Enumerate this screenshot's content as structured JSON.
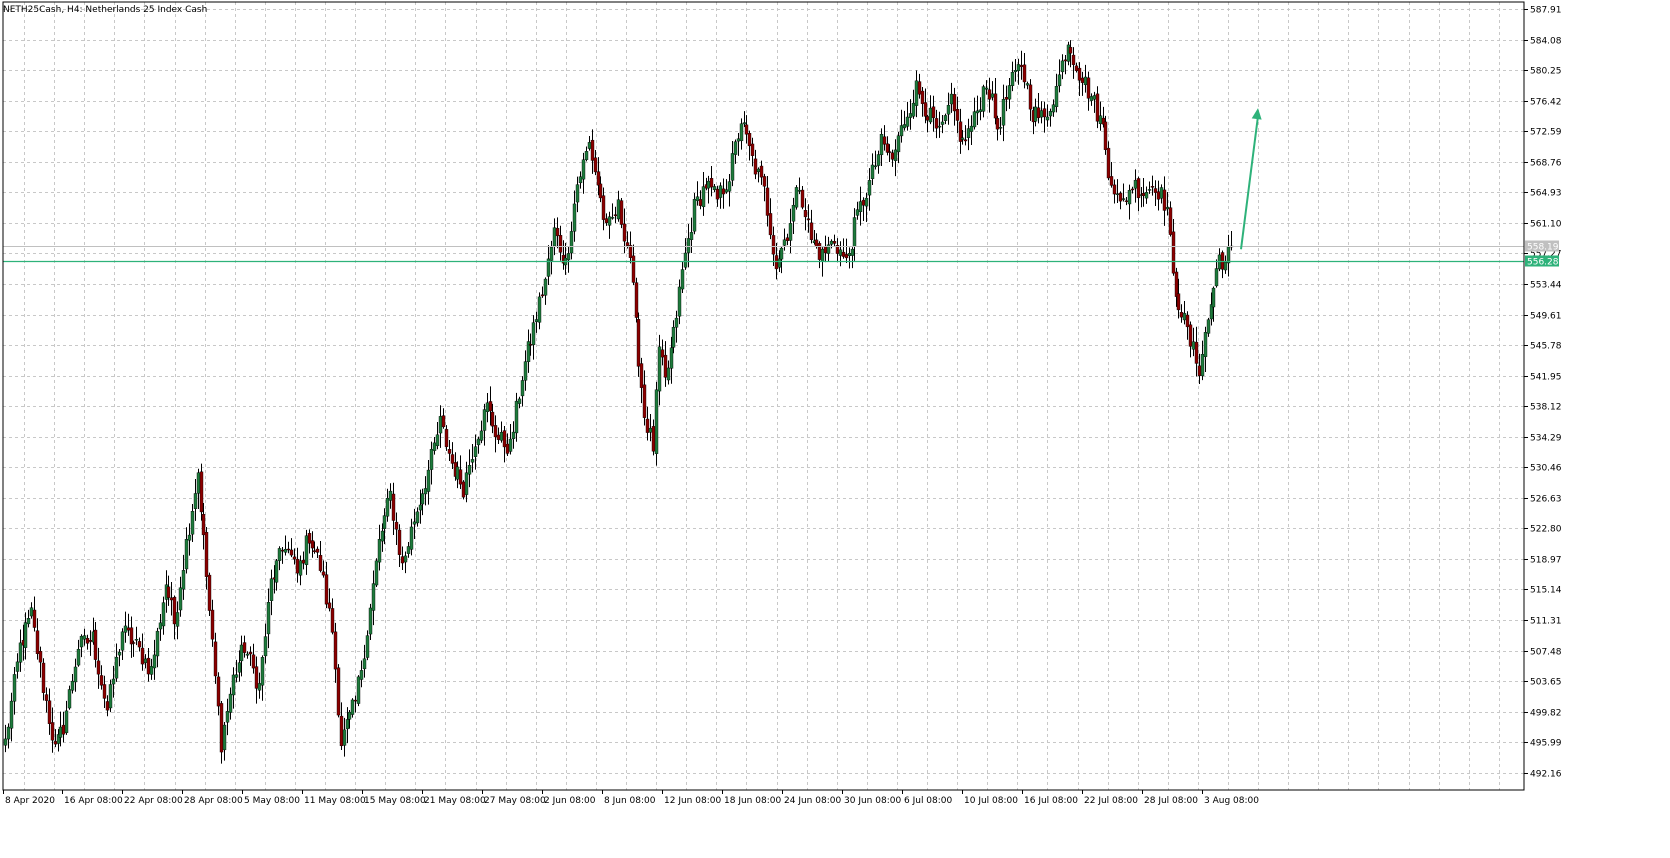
{
  "window": {
    "title": "NETH25Cash, H4:  Netherlands 25 Index Cash"
  },
  "colors": {
    "bull": "#1e7a3c",
    "bear": "#8b0000",
    "grid": "#c8c8c8",
    "level": "#2eb27a",
    "arrow": "#2eb27a",
    "bid": "#c0c0c0"
  },
  "chart_data": {
    "type": "candlestick",
    "title": "NETH25Cash, H4:  Netherlands 25 Index Cash",
    "ylim": [
      490.0,
      588.8
    ],
    "y_ticks": [
      "587.91",
      "584.08",
      "580.25",
      "576.42",
      "572.59",
      "568.76",
      "564.93",
      "561.10",
      "557.27",
      "553.44",
      "549.61",
      "545.78",
      "541.95",
      "538.12",
      "534.29",
      "530.46",
      "526.63",
      "522.80",
      "518.97",
      "515.14",
      "511.31",
      "507.48",
      "503.65",
      "499.82",
      "495.99",
      "492.16"
    ],
    "x_ticks": [
      "8 Apr 2020",
      "16 Apr 08:00",
      "22 Apr 08:00",
      "28 Apr 08:00",
      "5 May 08:00",
      "11 May 08:00",
      "15 May 08:00",
      "21 May 08:00",
      "27 May 08:00",
      "2 Jun 08:00",
      "8 Jun 08:00",
      "12 Jun 08:00",
      "18 Jun 08:00",
      "24 Jun 08:00",
      "30 Jun 08:00",
      "6 Jul 08:00",
      "10 Jul 08:00",
      "16 Jul 08:00",
      "22 Jul 08:00",
      "28 Jul 08:00",
      "3 Aug 08:00"
    ],
    "horizontal_level": {
      "value": 556.28,
      "label": "556.28"
    },
    "bid_line": {
      "value": 558.19,
      "label": "558.19"
    },
    "arrow": {
      "from": [
        557.8
      ],
      "to": [
        575.5
      ],
      "direction": "up"
    },
    "anchors": [
      [
        0,
        496.0
      ],
      [
        5,
        508.0
      ],
      [
        9,
        512.0
      ],
      [
        13,
        503.0
      ],
      [
        17,
        495.0
      ],
      [
        20,
        498.0
      ],
      [
        25,
        508.0
      ],
      [
        30,
        509.0
      ],
      [
        35,
        500.0
      ],
      [
        40,
        510.0
      ],
      [
        45,
        508.0
      ],
      [
        50,
        505.0
      ],
      [
        55,
        516.0
      ],
      [
        58,
        511.0
      ],
      [
        62,
        521.0
      ],
      [
        66,
        530.0
      ],
      [
        71,
        508.0
      ],
      [
        74,
        496.0
      ],
      [
        78,
        504.0
      ],
      [
        82,
        508.0
      ],
      [
        87,
        503.0
      ],
      [
        91,
        516.0
      ],
      [
        96,
        521.0
      ],
      [
        100,
        517.0
      ],
      [
        104,
        522.0
      ],
      [
        108,
        518.0
      ],
      [
        112,
        510.0
      ],
      [
        115,
        496.0
      ],
      [
        120,
        501.0
      ],
      [
        124,
        510.0
      ],
      [
        128,
        521.0
      ],
      [
        132,
        527.0
      ],
      [
        136,
        518.0
      ],
      [
        140,
        524.0
      ],
      [
        145,
        530.0
      ],
      [
        149,
        536.0
      ],
      [
        153,
        531.0
      ],
      [
        157,
        528.0
      ],
      [
        161,
        534.0
      ],
      [
        165,
        538.0
      ],
      [
        169,
        534.0
      ],
      [
        173,
        533.0
      ],
      [
        177,
        542.0
      ],
      [
        181,
        548.0
      ],
      [
        185,
        554.0
      ],
      [
        188,
        560.0
      ],
      [
        192,
        556.0
      ],
      [
        196,
        566.0
      ],
      [
        200,
        571.0
      ],
      [
        203,
        566.0
      ],
      [
        206,
        560.0
      ],
      [
        210,
        563.0
      ],
      [
        214,
        557.0
      ],
      [
        216,
        548.0
      ],
      [
        219,
        537.0
      ],
      [
        222,
        533.0
      ],
      [
        224,
        545.0
      ],
      [
        226,
        541.0
      ],
      [
        229,
        547.0
      ],
      [
        232,
        555.0
      ],
      [
        236,
        563.0
      ],
      [
        240,
        566.0
      ],
      [
        244,
        564.0
      ],
      [
        248,
        567.0
      ],
      [
        252,
        574.0
      ],
      [
        256,
        569.0
      ],
      [
        260,
        565.0
      ],
      [
        264,
        556.0
      ],
      [
        268,
        560.0
      ],
      [
        272,
        566.0
      ],
      [
        276,
        559.0
      ],
      [
        280,
        557.0
      ],
      [
        284,
        559.0
      ],
      [
        288,
        556.0
      ],
      [
        292,
        562.0
      ],
      [
        296,
        566.0
      ],
      [
        300,
        571.0
      ],
      [
        304,
        569.0
      ],
      [
        308,
        574.0
      ],
      [
        312,
        578.0
      ],
      [
        316,
        575.0
      ],
      [
        320,
        572.0
      ],
      [
        324,
        576.0
      ],
      [
        328,
        571.0
      ],
      [
        332,
        574.0
      ],
      [
        336,
        579.0
      ],
      [
        340,
        573.0
      ],
      [
        344,
        578.0
      ],
      [
        348,
        581.0
      ],
      [
        352,
        575.0
      ],
      [
        356,
        574.0
      ],
      [
        360,
        578.0
      ],
      [
        364,
        584.0
      ],
      [
        368,
        580.0
      ],
      [
        372,
        577.0
      ],
      [
        376,
        573.0
      ],
      [
        378,
        568.0
      ],
      [
        382,
        563.0
      ],
      [
        386,
        566.0
      ],
      [
        390,
        565.0
      ],
      [
        394,
        566.0
      ],
      [
        398,
        563.0
      ],
      [
        400,
        554.0
      ],
      [
        403,
        550.0
      ],
      [
        406,
        546.0
      ],
      [
        409,
        543.0
      ],
      [
        412,
        549.0
      ],
      [
        414,
        553.0
      ],
      [
        416,
        557.0
      ],
      [
        418,
        556.0
      ],
      [
        420,
        558.2
      ]
    ]
  }
}
